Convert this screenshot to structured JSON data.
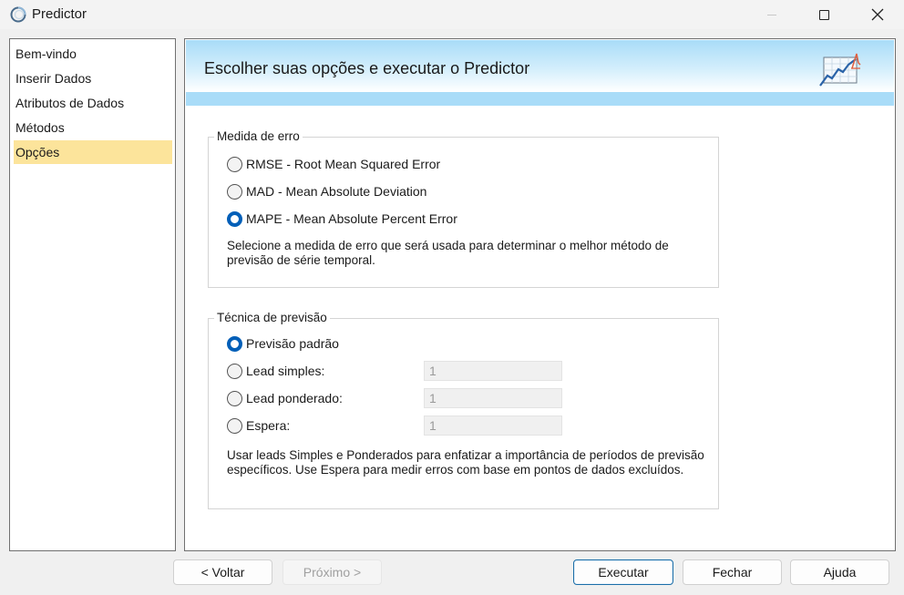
{
  "window": {
    "title": "Predictor",
    "controls": {
      "minimize": "minimize",
      "maximize": "maximize",
      "close": "close"
    }
  },
  "nav": {
    "items": [
      {
        "label": "Bem-vindo",
        "active": false
      },
      {
        "label": "Inserir Dados",
        "active": false
      },
      {
        "label": "Atributos de Dados",
        "active": false
      },
      {
        "label": "Métodos",
        "active": false
      },
      {
        "label": "Opções",
        "active": true
      }
    ]
  },
  "header": {
    "title": "Escolher suas opções e executar o Predictor",
    "icon": "chart-wizard-icon",
    "colors": {
      "band": "#a9dcf8",
      "accent": "#005fb8"
    }
  },
  "error_measure": {
    "legend": "Medida de erro",
    "options": [
      {
        "label": "RMSE - Root Mean Squared Error",
        "checked": false
      },
      {
        "label": "MAD - Mean Absolute Deviation",
        "checked": false
      },
      {
        "label": "MAPE - Mean Absolute Percent Error",
        "checked": true
      }
    ],
    "help": "Selecione a medida de erro que será usada para determinar o melhor método de previsão de série temporal."
  },
  "forecast_technique": {
    "legend": "Técnica de previsão",
    "options": [
      {
        "label": "Previsão padrão",
        "checked": true,
        "value": null
      },
      {
        "label": "Lead simples:",
        "checked": false,
        "value": "1"
      },
      {
        "label": "Lead ponderado:",
        "checked": false,
        "value": "1"
      },
      {
        "label": "Espera:",
        "checked": false,
        "value": "1"
      }
    ],
    "help": "Usar leads Simples e Ponderados para enfatizar a importância de períodos de previsão específicos.  Use Espera para medir erros com base em pontos de dados excluídos."
  },
  "buttons": {
    "back": "< Voltar",
    "next": "Próximo >",
    "run": "Executar",
    "close": "Fechar",
    "help": "Ajuda"
  }
}
